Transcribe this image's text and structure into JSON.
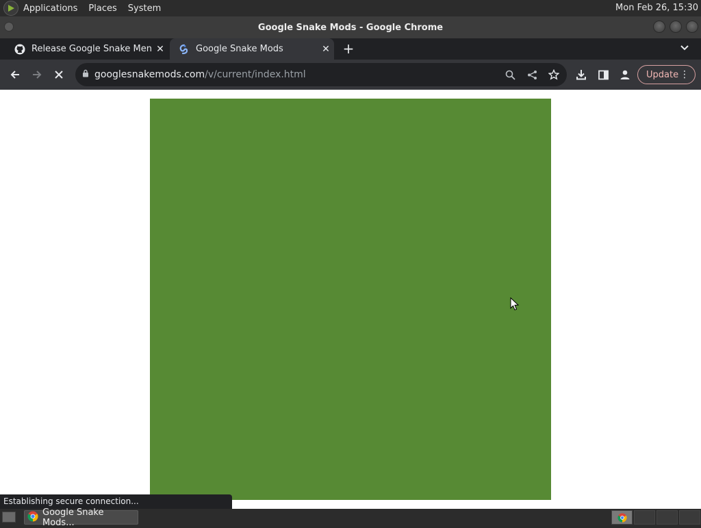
{
  "system_panel": {
    "menus": [
      "Applications",
      "Places",
      "System"
    ],
    "clock": "Mon Feb 26, 15:30"
  },
  "window": {
    "title": "Google Snake Mods - Google Chrome"
  },
  "tabs": [
    {
      "title": "Release Google Snake Menu M",
      "icon": "github-icon",
      "active": false
    },
    {
      "title": "Google Snake Mods",
      "icon": "snake-mods-icon",
      "active": true
    }
  ],
  "toolbar": {
    "url_host": "googlesnakemods.com",
    "url_path": "/v/current/index.html",
    "update_label": "Update"
  },
  "content": {
    "game_background_color": "#578a34"
  },
  "status_bar": {
    "text": "Establishing secure connection..."
  },
  "taskbar": {
    "task_label": "Google Snake Mods..."
  },
  "colors": {
    "chrome_dark": "#202124",
    "toolbar": "#35363a",
    "accent_update": "#f2b8b5"
  }
}
